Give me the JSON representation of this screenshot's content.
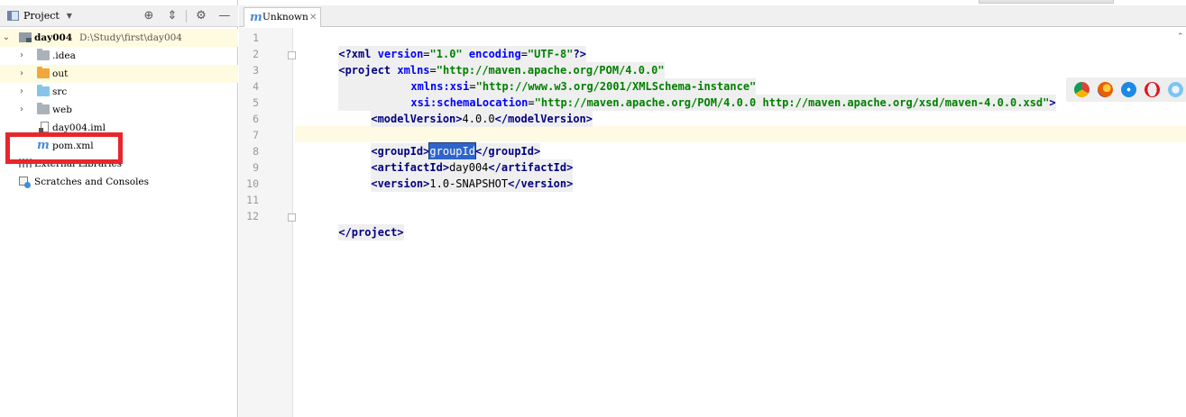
{
  "project_panel": {
    "title": "Project",
    "tree": [
      {
        "label": "day004",
        "path": "D:\\Study\\first\\day004",
        "icon": "module-folder-icon",
        "expanded": true
      },
      {
        "label": ".idea",
        "icon": "folder-icon"
      },
      {
        "label": "out",
        "icon": "folder-icon"
      },
      {
        "label": "src",
        "icon": "folder-icon"
      },
      {
        "label": "web",
        "icon": "folder-icon"
      },
      {
        "label": "day004.iml",
        "icon": "iml-file-icon"
      },
      {
        "label": "pom.xml",
        "icon": "maven-file-icon"
      },
      {
        "label": "External Libraries",
        "icon": "libraries-icon"
      },
      {
        "label": "Scratches and Consoles",
        "icon": "scratches-icon"
      }
    ]
  },
  "editor": {
    "tab": {
      "label": "Unknown",
      "icon": "maven-file-icon"
    },
    "line_numbers": [
      "1",
      "2",
      "3",
      "4",
      "5",
      "6",
      "7",
      "8",
      "9",
      "10",
      "11",
      "12"
    ],
    "code": {
      "l1": {
        "open": "<?xml ",
        "a1": "version",
        "eq1": "=",
        "v1": "\"1.0\"",
        "sp": " ",
        "a2": "encoding",
        "eq2": "=",
        "v2": "\"UTF-8\"",
        "close": "?>"
      },
      "l2": {
        "open": "<project ",
        "attr": "xmlns",
        "eq": "=",
        "val": "\"http://maven.apache.org/POM/4.0.0\""
      },
      "l3": {
        "attr": "xmlns:xsi",
        "eq": "=",
        "val": "\"http://www.w3.org/2001/XMLSchema-instance\""
      },
      "l4": {
        "attr": "xsi:schemaLocation",
        "eq": "=",
        "val": "\"http://maven.apache.org/POM/4.0.0 http://maven.apache.org/xsd/maven-4.0.0.xsd\"",
        "close": ">"
      },
      "l5": {
        "open": "<modelVersion>",
        "text": "4.0.0",
        "close": "</modelVersion>"
      },
      "l7": {
        "open": "<groupId>",
        "text": "groupId",
        "close": "</groupId>"
      },
      "l8": {
        "open": "<artifactId>",
        "text": "day004",
        "close": "</artifactId>"
      },
      "l9": {
        "open": "<version>",
        "text": "1.0-SNAPSHOT",
        "close": "</version>"
      },
      "l12": {
        "close": "</project>"
      }
    },
    "browser_icons": [
      "chrome-icon",
      "firefox-icon",
      "safari-icon",
      "opera-icon",
      "ie-icon",
      "edge-icon"
    ]
  },
  "colors": {
    "highlight_box": "#e8262b",
    "selection": "#2f65ca",
    "tag": "#000080",
    "attribute": "#0000ff",
    "value": "#008000"
  }
}
